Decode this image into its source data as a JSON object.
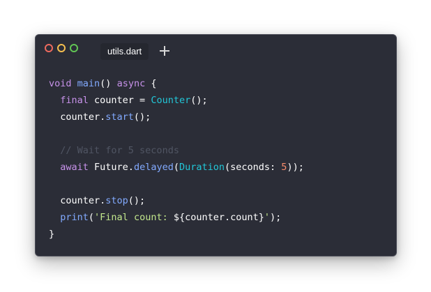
{
  "window": {
    "tab_label": "utils.dart",
    "new_tab_icon": "plus-icon",
    "controls": [
      "close-dot",
      "minimize-dot",
      "maximize-dot"
    ]
  },
  "colors": {
    "background": "#2b2d37",
    "keyword": "#c792ea",
    "function": "#82aaff",
    "class": "#22c7d8",
    "plain": "#ffffff",
    "comment": "#505563",
    "string": "#c3e88d",
    "number": "#f78c6c"
  },
  "code": {
    "lines": [
      [
        [
          "kw",
          "void"
        ],
        [
          "pl",
          " "
        ],
        [
          "fn",
          "main"
        ],
        [
          "pl",
          "() "
        ],
        [
          "kw",
          "async"
        ],
        [
          "pl",
          " {"
        ]
      ],
      [
        [
          "pl",
          "  "
        ],
        [
          "kw",
          "final"
        ],
        [
          "pl",
          " counter = "
        ],
        [
          "cls",
          "Counter"
        ],
        [
          "pl",
          "();"
        ]
      ],
      [
        [
          "pl",
          "  counter."
        ],
        [
          "fn",
          "start"
        ],
        [
          "pl",
          "();"
        ]
      ],
      [],
      [
        [
          "pl",
          "  "
        ],
        [
          "cm",
          "// Wait for 5 seconds"
        ]
      ],
      [
        [
          "pl",
          "  "
        ],
        [
          "kw",
          "await"
        ],
        [
          "pl",
          " Future."
        ],
        [
          "fn",
          "delayed"
        ],
        [
          "pl",
          "("
        ],
        [
          "cls",
          "Duration"
        ],
        [
          "pl",
          "(seconds: "
        ],
        [
          "num",
          "5"
        ],
        [
          "pl",
          "));"
        ]
      ],
      [],
      [
        [
          "pl",
          "  counter."
        ],
        [
          "fn",
          "stop"
        ],
        [
          "pl",
          "();"
        ]
      ],
      [
        [
          "pl",
          "  "
        ],
        [
          "fn",
          "print"
        ],
        [
          "pl",
          "("
        ],
        [
          "str",
          "'Final count: "
        ],
        [
          "pl",
          "${counter.count}"
        ],
        [
          "str",
          "'"
        ],
        [
          "pl",
          ");"
        ]
      ],
      [
        [
          "pl",
          "}"
        ]
      ]
    ]
  }
}
